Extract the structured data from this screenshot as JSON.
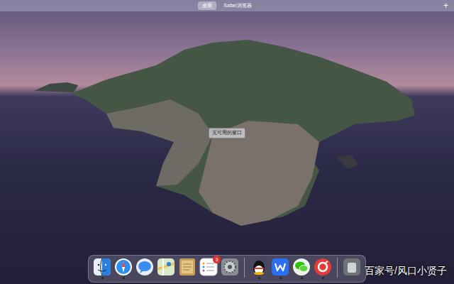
{
  "menu_bar": {
    "spaces": [
      {
        "label": "桌面",
        "selected": true
      },
      {
        "label": "Safari浏览器",
        "selected": false
      }
    ],
    "add_button": "+"
  },
  "desktop": {
    "empty_label": "无可用的窗口"
  },
  "dock": {
    "items": [
      {
        "running": true
      },
      {
        "running": true
      },
      {
        "running": false
      },
      {
        "running": false
      },
      {
        "running": false
      },
      {
        "running": false,
        "badge": "3"
      },
      {
        "running": false
      },
      {
        "running": true
      },
      {
        "running": true
      },
      {
        "running": true
      },
      {
        "running": true
      },
      {
        "running": false
      }
    ]
  },
  "watermark": "百家号/风口小贤子"
}
